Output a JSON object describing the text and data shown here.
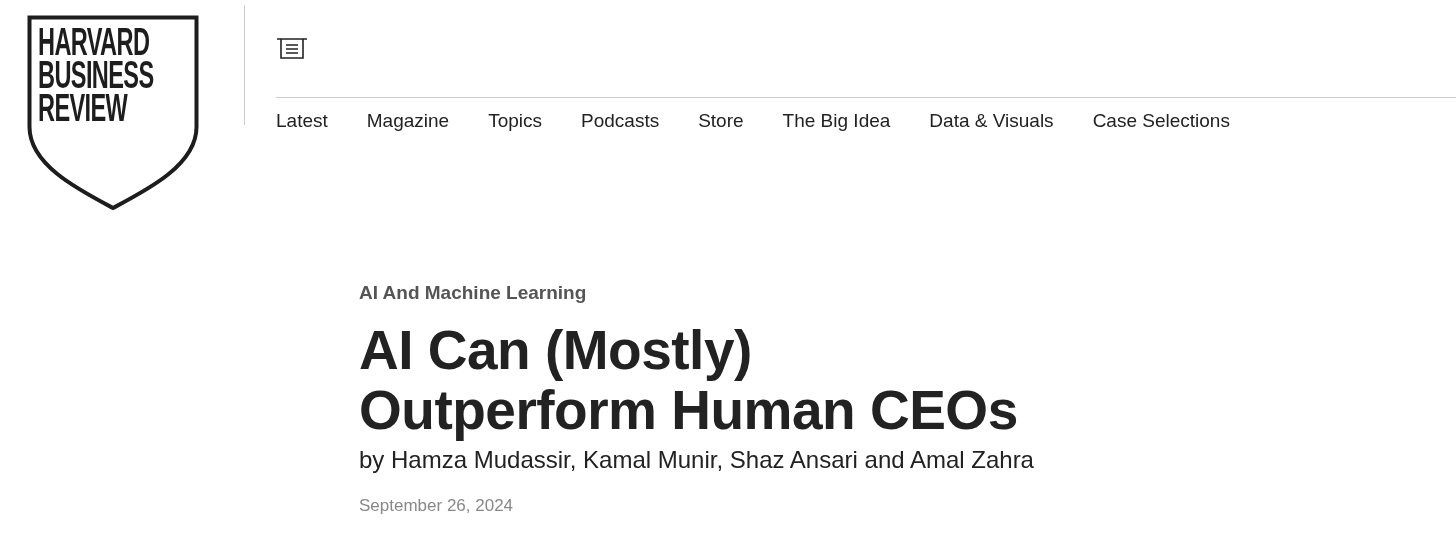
{
  "logo": {
    "lines": [
      "HARVARD",
      "BUSINESS",
      "REVIEW"
    ]
  },
  "nav": {
    "items": [
      {
        "label": "Latest"
      },
      {
        "label": "Magazine"
      },
      {
        "label": "Topics"
      },
      {
        "label": "Podcasts"
      },
      {
        "label": "Store"
      },
      {
        "label": "The Big Idea"
      },
      {
        "label": "Data & Visuals"
      },
      {
        "label": "Case Selections"
      }
    ]
  },
  "article": {
    "topic": "AI And Machine Learning",
    "title_lines": [
      "AI Can (Mostly)",
      "Outperform Human CEOs"
    ],
    "byline": "by Hamza Mudassir, Kamal Munir, Shaz Ansari and Amal Zahra",
    "date": "September 26, 2024"
  }
}
